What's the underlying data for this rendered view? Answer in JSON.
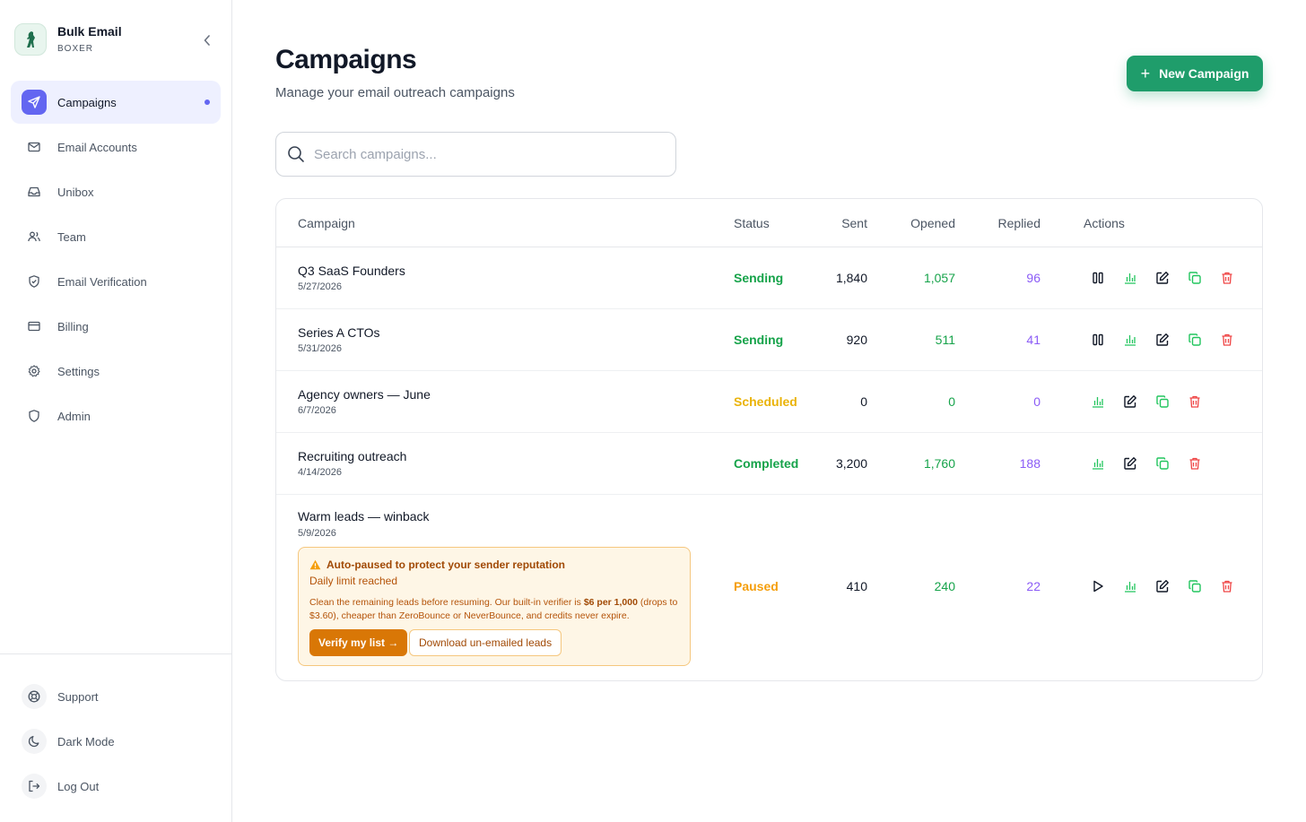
{
  "brand": {
    "title": "Bulk Email",
    "subtitle": "BOXER",
    "logo_icon": "boxer-logo-icon"
  },
  "sidebar": {
    "items": [
      {
        "label": "Campaigns",
        "icon": "send-icon",
        "active": true
      },
      {
        "label": "Email Accounts",
        "icon": "mail-icon"
      },
      {
        "label": "Unibox",
        "icon": "inbox-icon"
      },
      {
        "label": "Team",
        "icon": "users-icon"
      },
      {
        "label": "Email Verification",
        "icon": "shield-check-icon"
      },
      {
        "label": "Billing",
        "icon": "credit-card-icon"
      },
      {
        "label": "Settings",
        "icon": "gear-icon"
      },
      {
        "label": "Admin",
        "icon": "shield-icon"
      }
    ],
    "bottom": [
      {
        "label": "Support",
        "icon": "lifebuoy-icon"
      },
      {
        "label": "Dark Mode",
        "icon": "moon-icon"
      },
      {
        "label": "Log Out",
        "icon": "logout-icon"
      }
    ]
  },
  "header": {
    "title": "Campaigns",
    "subtitle": "Manage your email outreach campaigns",
    "new_button": "New Campaign"
  },
  "search": {
    "placeholder": "Search campaigns..."
  },
  "table": {
    "columns": [
      "Campaign",
      "Status",
      "Sent",
      "Opened",
      "Replied",
      "Actions"
    ],
    "rows": [
      {
        "name": "Q3 SaaS Founders",
        "date": "5/27/2026",
        "status": "Sending",
        "sent": "1,840",
        "opened": "1,057",
        "replied": "96"
      },
      {
        "name": "Series A CTOs",
        "date": "5/31/2026",
        "status": "Sending",
        "sent": "920",
        "opened": "511",
        "replied": "41"
      },
      {
        "name": "Agency owners — June",
        "date": "6/7/2026",
        "status": "Scheduled",
        "sent": "0",
        "opened": "0",
        "replied": "0"
      },
      {
        "name": "Recruiting outreach",
        "date": "4/14/2026",
        "status": "Completed",
        "sent": "3,200",
        "opened": "1,760",
        "replied": "188"
      },
      {
        "name": "Warm leads — winback",
        "date": "5/9/2026",
        "status": "Paused",
        "sent": "410",
        "opened": "240",
        "replied": "22"
      }
    ]
  },
  "warning": {
    "title": "Auto-paused to protect your sender reputation",
    "subtitle": "Daily limit reached",
    "text_before": "Clean the remaining leads before resuming. Our built-in verifier is ",
    "price": "$6 per 1,000",
    "text_after": " (drops to $3.60), cheaper than ZeroBounce or NeverBounce, and credits never expire.",
    "verify_button": "Verify my list →",
    "download_button": "Download un-emailed leads"
  },
  "colors": {
    "accent": "#6366f1",
    "primary_green": "#1f9d6b",
    "sending": "#16a34a",
    "scheduled": "#eab308",
    "completed": "#16a34a",
    "paused": "#f59e0b",
    "replied": "#8b5cf6",
    "delete": "#ef4444"
  }
}
